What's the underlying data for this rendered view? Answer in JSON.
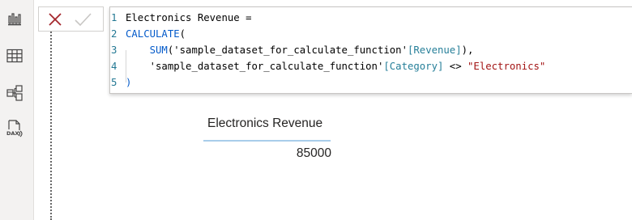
{
  "left_rail": {
    "icons": [
      "report-view-icon",
      "table-view-icon",
      "model-view-icon",
      "dax-query-view-icon"
    ]
  },
  "commit_bar": {
    "cancel_icon": "close-x-icon",
    "commit_icon": "check-icon",
    "cancel_color": "#a4262c",
    "commit_color": "#c8c6c4"
  },
  "editor": {
    "lines": [
      {
        "number": "1",
        "tokens": [
          {
            "t": "Electronics Revenue =",
            "k": "ident"
          }
        ]
      },
      {
        "number": "2",
        "tokens": [
          {
            "t": "CALCULATE",
            "k": "fn"
          },
          {
            "t": "(",
            "k": "punct"
          }
        ]
      },
      {
        "number": "3",
        "tokens": [
          {
            "t": "    ",
            "k": "punct"
          },
          {
            "t": "SUM",
            "k": "fn"
          },
          {
            "t": "(",
            "k": "punct"
          },
          {
            "t": "'sample_dataset_for_calculate_function'",
            "k": "ident"
          },
          {
            "t": "[Revenue]",
            "k": "col"
          },
          {
            "t": "),",
            "k": "punct"
          }
        ]
      },
      {
        "number": "4",
        "tokens": [
          {
            "t": "    ",
            "k": "punct"
          },
          {
            "t": "'sample_dataset_for_calculate_function'",
            "k": "ident"
          },
          {
            "t": "[Category]",
            "k": "col"
          },
          {
            "t": " <> ",
            "k": "op"
          },
          {
            "t": "\"Electronics\"",
            "k": "str"
          }
        ]
      },
      {
        "number": "5",
        "tokens": [
          {
            "t": ")",
            "k": "fn"
          }
        ]
      }
    ]
  },
  "table_visual": {
    "header": "Electronics Revenue",
    "value": "85000"
  }
}
